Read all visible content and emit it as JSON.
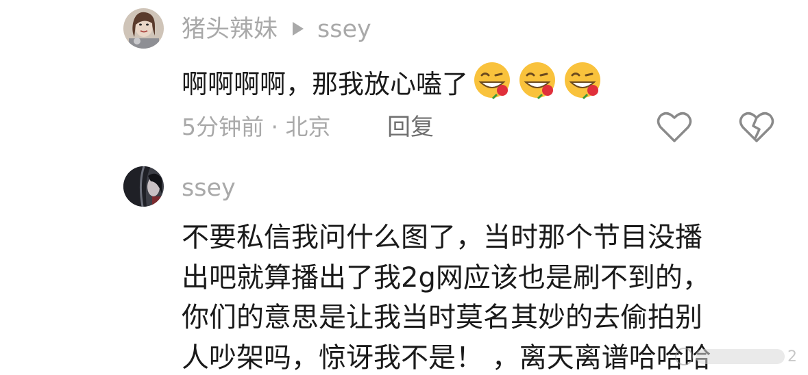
{
  "comment1": {
    "username": "猪头辣妹",
    "reply_to": "ssey",
    "text": "啊啊啊啊，那我放心嗑了",
    "emojis": [
      "grin-with-rose-emoji",
      "grin-with-rose-emoji",
      "grin-with-rose-emoji"
    ],
    "time_location": "5分钟前 · 北京",
    "reply_label": "回复",
    "like_icon": "heart-outline-icon",
    "dislike_icon": "broken-heart-icon"
  },
  "comment2": {
    "username": "ssey",
    "lines": [
      "不要私信我问什么图了，当时那个节目没播",
      "出吧就算播出了我2g网应该也是刷不到的，",
      "你们的意思是让我当时莫名其妙的去偷拍别",
      "人吵架吗，惊讶我不是！ ，离天离谱哈哈哈"
    ]
  },
  "watermark": {
    "suffix": "2"
  },
  "colors": {
    "text_primary": "#1a1a1a",
    "text_secondary": "#a9a9a9",
    "reply_text": "#6f6f6f",
    "background": "#ffffff"
  }
}
